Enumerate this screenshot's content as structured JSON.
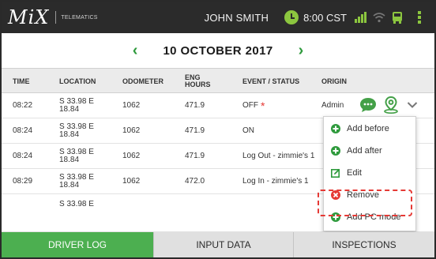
{
  "header": {
    "logo_text": "MiX",
    "logo_subtext": "TELEMATICS",
    "user_name": "JOHN SMITH",
    "time": "8:00 CST",
    "icons": [
      "clock-icon",
      "signal-icon",
      "wifi-icon",
      "truck-icon",
      "menu-icon"
    ]
  },
  "date_nav": {
    "prev_glyph": "‹",
    "date": "10 OCTOBER 2017",
    "next_glyph": "›"
  },
  "table": {
    "columns": [
      "TIME",
      "LOCATION",
      "ODOMETER",
      "ENG HOURS",
      "EVENT / STATUS",
      "ORIGIN"
    ],
    "rows": [
      {
        "time": "08:22",
        "location": "S 33.98 E 18.84",
        "odometer": "1062",
        "eng_hours": "471.9",
        "event": "OFF",
        "origin": "Admin",
        "flag": "*"
      },
      {
        "time": "08:24",
        "location": "S 33.98 E 18.84",
        "odometer": "1062",
        "eng_hours": "471.9",
        "event": "ON",
        "origin": ""
      },
      {
        "time": "08:24",
        "location": "S 33.98 E 18.84",
        "odometer": "1062",
        "eng_hours": "471.9",
        "event": "Log Out - zimmie's 1",
        "origin": ""
      },
      {
        "time": "08:29",
        "location": "S 33.98 E 18.84",
        "odometer": "1062",
        "eng_hours": "472.0",
        "event": "Log In - zimmie's 1",
        "origin": ""
      },
      {
        "time": "",
        "location": "S 33.98 E",
        "odometer": "",
        "eng_hours": "",
        "event": "",
        "origin": ""
      }
    ]
  },
  "row_menu": {
    "items": [
      {
        "label": "Add before",
        "icon": "plus-circle-icon",
        "color": "#2e9a3c"
      },
      {
        "label": "Add after",
        "icon": "plus-circle-icon",
        "color": "#2e9a3c"
      },
      {
        "label": "Edit",
        "icon": "edit-icon",
        "color": "#2e9a3c"
      },
      {
        "label": "Remove",
        "icon": "remove-circle-icon",
        "color": "#e53935"
      },
      {
        "label": "Add PC mode",
        "icon": "plus-circle-icon",
        "color": "#2e9a3c"
      }
    ]
  },
  "tabs": [
    {
      "label": "DRIVER LOG",
      "active": true
    },
    {
      "label": "INPUT DATA",
      "active": false
    },
    {
      "label": "INSPECTIONS",
      "active": false
    }
  ],
  "colors": {
    "accent": "#4caf50",
    "top_bar": "#2b2b2b",
    "alert": "#e53935"
  }
}
